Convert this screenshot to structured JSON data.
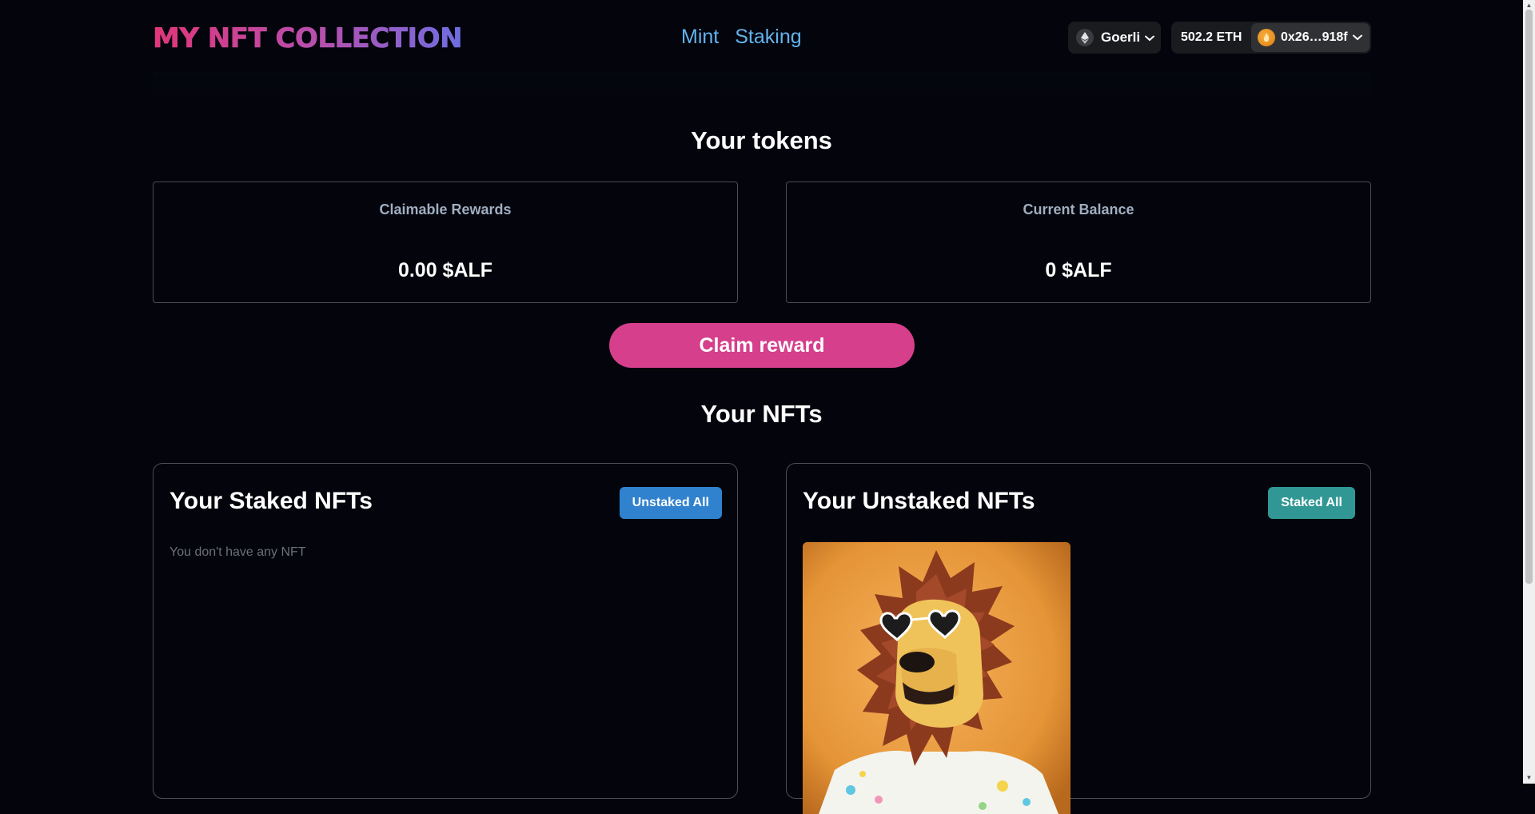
{
  "header": {
    "logo": "MY NFT COLLECTION",
    "nav": [
      {
        "label": "Mint"
      },
      {
        "label": "Staking"
      }
    ],
    "network": {
      "label": "Goerli",
      "icon": "ethereum-icon"
    },
    "wallet": {
      "balance": "502.2 ETH",
      "address": "0x26…918f",
      "icon": "avatar-icon"
    }
  },
  "tokens": {
    "title": "Your tokens",
    "claimable": {
      "label": "Claimable Rewards",
      "value": "0.00 $ALF"
    },
    "balance": {
      "label": "Current Balance",
      "value": "0 $ALF"
    },
    "claim_button": "Claim reward"
  },
  "nfts": {
    "title": "Your NFTs",
    "staked": {
      "title": "Your Staked NFTs",
      "button": "Unstaked All",
      "button_color": "#3182ce",
      "empty": "You don't have any NFT"
    },
    "unstaked": {
      "title": "Your Unstaked NFTs",
      "button": "Staked All",
      "button_color": "#319795",
      "items": [
        {
          "image": "lion-nft-icon"
        }
      ]
    }
  },
  "colors": {
    "background": "#03040c",
    "link": "#63b3ed",
    "claim": "#d53f8c"
  }
}
